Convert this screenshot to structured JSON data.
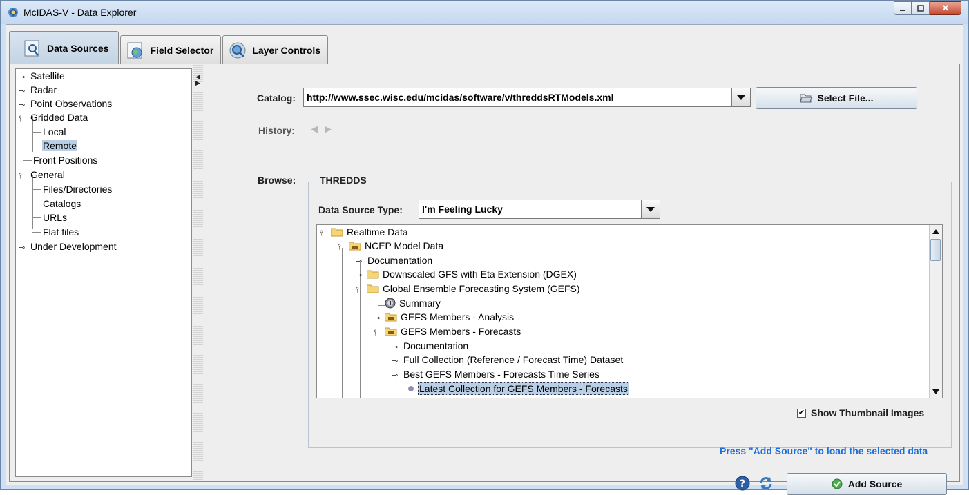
{
  "window": {
    "title": "McIDAS-V - Data Explorer"
  },
  "tabs": [
    {
      "label": "Data Sources",
      "icon": "magnifier-icon"
    },
    {
      "label": "Field Selector",
      "icon": "globe-icon"
    },
    {
      "label": "Layer Controls",
      "icon": "layers-icon"
    }
  ],
  "left_tree": {
    "items": [
      {
        "label": "Satellite"
      },
      {
        "label": "Radar"
      },
      {
        "label": "Point Observations"
      },
      {
        "label": "Gridded Data"
      },
      {
        "label": "Local"
      },
      {
        "label": "Remote"
      },
      {
        "label": "Front Positions"
      },
      {
        "label": "General"
      },
      {
        "label": "Files/Directories"
      },
      {
        "label": "Catalogs"
      },
      {
        "label": "URLs"
      },
      {
        "label": "Flat files"
      },
      {
        "label": "Under Development"
      }
    ]
  },
  "catalog": {
    "label": "Catalog:",
    "value": "http://www.ssec.wisc.edu/mcidas/software/v/threddsRTModels.xml",
    "select_file_label": "Select File..."
  },
  "history": {
    "label": "History:"
  },
  "browse": {
    "label": "Browse:",
    "group_title": "THREDDS",
    "data_source_type_label": "Data Source Type:",
    "data_source_type_value": "I'm Feeling Lucky"
  },
  "thredds_tree": {
    "items": [
      {
        "label": "Realtime Data"
      },
      {
        "label": "NCEP Model Data"
      },
      {
        "label": "Documentation"
      },
      {
        "label": "Downscaled GFS with Eta Extension (DGEX)"
      },
      {
        "label": "Global Ensemble Forecasting System (GEFS)"
      },
      {
        "label": "Summary"
      },
      {
        "label": "GEFS Members - Analysis"
      },
      {
        "label": "GEFS Members - Forecasts"
      },
      {
        "label": "Documentation"
      },
      {
        "label": "Full Collection (Reference / Forecast Time) Dataset"
      },
      {
        "label": "Best GEFS Members - Forecasts Time Series"
      },
      {
        "label": "Latest Collection for GEFS Members - Forecasts"
      }
    ]
  },
  "thumbnail": {
    "label": "Show Thumbnail Images",
    "checked": true
  },
  "hint": "Press \"Add Source\" to load the selected data",
  "add_source_label": "Add Source"
}
